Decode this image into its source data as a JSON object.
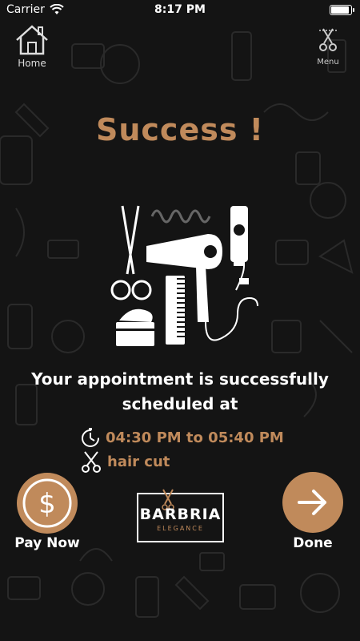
{
  "status_bar": {
    "carrier": "Carrier",
    "time": "8:17 PM"
  },
  "nav": {
    "home_label": "Home",
    "home_icon": "home-icon",
    "menu_label": "Menu",
    "menu_icon": "scissors-comb-icon"
  },
  "page": {
    "title": "Success !",
    "message_line1": "Your appointment is successfully",
    "message_line2": "scheduled at",
    "time_range": "04:30 PM to 05:40 PM",
    "service": "hair cut",
    "time_icon": "timer-icon",
    "service_icon": "scissors-icon",
    "illustration": "barber-tools-illustration"
  },
  "actions": {
    "pay_now_label": "Pay Now",
    "pay_icon": "dollar-icon",
    "done_label": "Done",
    "done_icon": "arrow-right-icon"
  },
  "logo": {
    "word": "BARBRIA",
    "sub": "ELEGANCE"
  },
  "colors": {
    "accent": "#c08a5b",
    "background": "#141414",
    "text": "#ffffff"
  }
}
